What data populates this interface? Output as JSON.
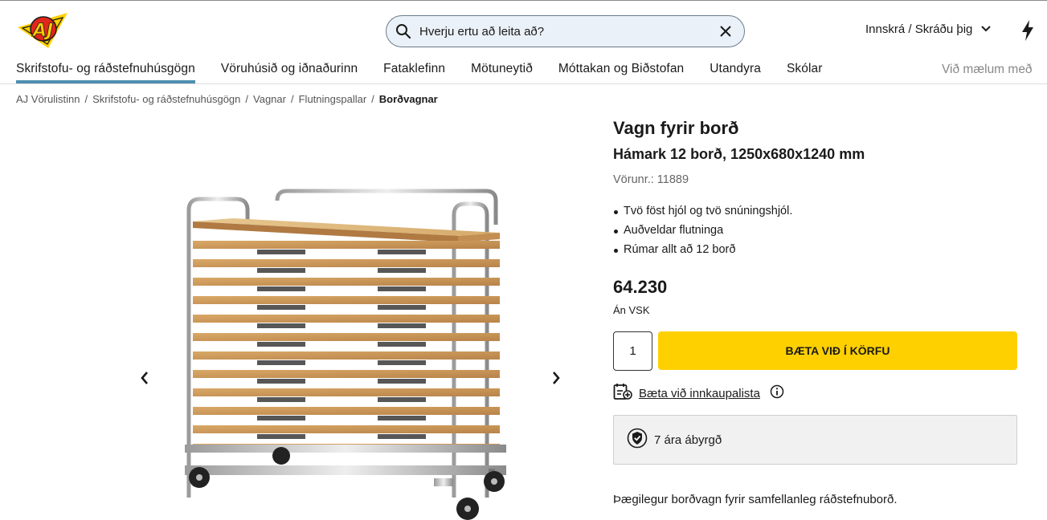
{
  "header": {
    "logo_text": "AJ",
    "search": {
      "placeholder": "Hverju ertu að leita að?"
    },
    "login_label": "Innskrá / Skráðu þig"
  },
  "nav": {
    "items": [
      {
        "label": "Skrifstofu- og ráðstefnuhúsgögn",
        "active": true
      },
      {
        "label": "Vöruhúsið og iðnaðurinn"
      },
      {
        "label": "Fataklefinn"
      },
      {
        "label": "Mötuneytið"
      },
      {
        "label": "Móttakan og Biðstofan"
      },
      {
        "label": "Utandyra"
      },
      {
        "label": "Skólar"
      }
    ],
    "right_label": "Við mælum með"
  },
  "breadcrumb": [
    "AJ Vörulistinn",
    "Skrifstofu- og ráðstefnuhúsgögn",
    "Vagnar",
    "Flutningspallar",
    "Borðvagnar"
  ],
  "product": {
    "title": "Vagn fyrir borð",
    "subtitle": "Hámark 12 borð, 1250x680x1240 mm",
    "sku": "Vörunr.: 11889",
    "bullets": [
      "Tvö föst hjól og tvö snúningshjól.",
      "Auðveldar flutninga",
      "Rúmar allt að 12 borð"
    ],
    "price": "64.230",
    "vat_note": "Án VSK",
    "quantity": "1",
    "add_to_cart": "BÆTA VIÐ Í KÖRFU",
    "wishlist_label": "Bæta við innkaupalista",
    "warranty": "7 ára ábyrgð",
    "description": "Þægilegur borðvagn fyrir samfellanleg ráðstefnuborð."
  },
  "colors": {
    "accent_yellow": "#ffd000",
    "nav_underline": "#4e8fb0",
    "search_bg": "#eaf1f8",
    "logo_red": "#e1261c"
  }
}
